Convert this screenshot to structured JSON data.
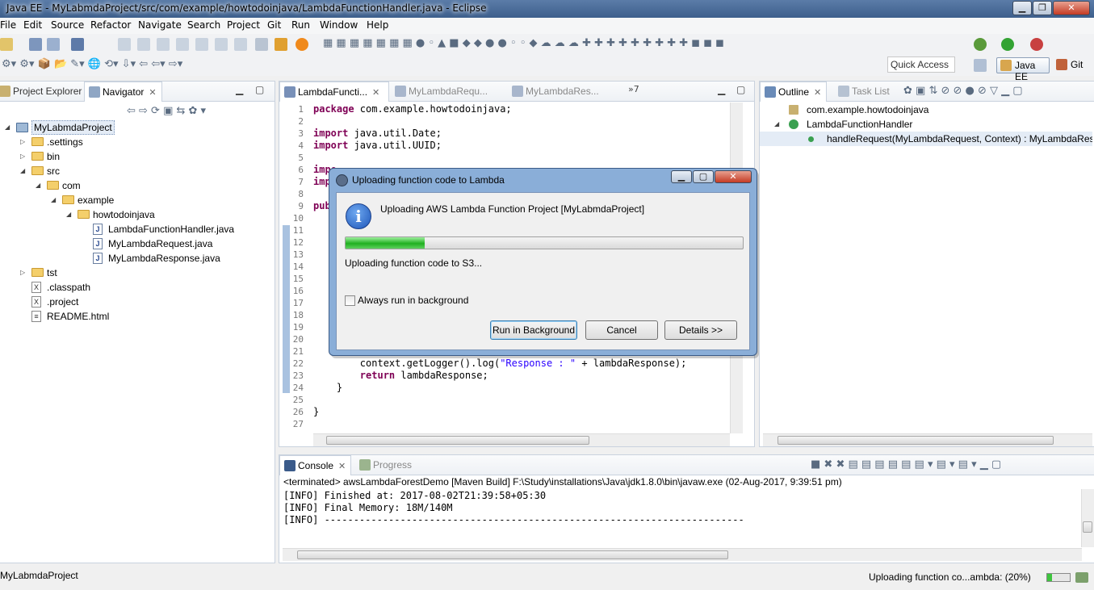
{
  "window": {
    "title": "Java EE - MyLabmdaProject/src/com/example/howtodoinjava/LambdaFunctionHandler.java - Eclipse"
  },
  "menu": [
    "File",
    "Edit",
    "Source",
    "Refactor",
    "Navigate",
    "Search",
    "Project",
    "Git",
    "Run",
    "Window",
    "Help"
  ],
  "quick_access": {
    "placeholder": "Quick Access"
  },
  "perspectives": {
    "java_ee": "Java EE",
    "git": "Git"
  },
  "left_panel": {
    "tabs": [
      "Project Explorer",
      "Navigator"
    ],
    "tree": [
      {
        "label": "MyLabmdaProject",
        "type": "project",
        "depth": 0,
        "expanded": true
      },
      {
        "label": ".settings",
        "type": "folder",
        "depth": 1,
        "expanded": false
      },
      {
        "label": "bin",
        "type": "folder",
        "depth": 1,
        "expanded": false
      },
      {
        "label": "src",
        "type": "folder",
        "depth": 1,
        "expanded": true
      },
      {
        "label": "com",
        "type": "folder",
        "depth": 2,
        "expanded": true
      },
      {
        "label": "example",
        "type": "folder",
        "depth": 3,
        "expanded": true
      },
      {
        "label": "howtodoinjava",
        "type": "folder",
        "depth": 4,
        "expanded": true
      },
      {
        "label": "LambdaFunctionHandler.java",
        "type": "java",
        "depth": 5
      },
      {
        "label": "MyLambdaRequest.java",
        "type": "java",
        "depth": 5
      },
      {
        "label": "MyLambdaResponse.java",
        "type": "java",
        "depth": 5
      },
      {
        "label": "tst",
        "type": "folder",
        "depth": 1,
        "expanded": false
      },
      {
        "label": ".classpath",
        "type": "xml",
        "depth": 1
      },
      {
        "label": ".project",
        "type": "xml",
        "depth": 1
      },
      {
        "label": "README.html",
        "type": "html",
        "depth": 1
      }
    ]
  },
  "editor": {
    "tabs": [
      "LambdaFuncti...",
      "MyLambdaRequ...",
      "MyLambdaRes..."
    ],
    "overflow": "»7",
    "lines": [
      {
        "n": "1",
        "t": "package com.example.howtodoinjava;"
      },
      {
        "n": "2",
        "t": ""
      },
      {
        "n": "3",
        "t": "import java.util.Date;"
      },
      {
        "n": "4",
        "t": "import java.util.UUID;"
      },
      {
        "n": "5",
        "t": ""
      },
      {
        "n": "6",
        "t": "impo"
      },
      {
        "n": "7",
        "t": "impo"
      },
      {
        "n": "8",
        "t": ""
      },
      {
        "n": "9",
        "t": "publ"
      },
      {
        "n": "10",
        "t": ""
      },
      {
        "n": "11",
        "t": ""
      },
      {
        "n": "12",
        "t": ""
      },
      {
        "n": "13",
        "t": ""
      },
      {
        "n": "14",
        "t": ""
      },
      {
        "n": "15",
        "t": ""
      },
      {
        "n": "16",
        "t": ""
      },
      {
        "n": "17",
        "t": ""
      },
      {
        "n": "18",
        "t": ""
      },
      {
        "n": "19",
        "t": ""
      },
      {
        "n": "20",
        "t": ""
      },
      {
        "n": "21",
        "t": ""
      },
      {
        "n": "22",
        "t": "        context.getLogger().log(\"Response : \" + lambdaResponse);"
      },
      {
        "n": "23",
        "t": "        return lambdaResponse;"
      },
      {
        "n": "24",
        "t": "    }"
      },
      {
        "n": "25",
        "t": ""
      },
      {
        "n": "26",
        "t": "}"
      },
      {
        "n": "27",
        "t": ""
      }
    ]
  },
  "outline": {
    "tabs": [
      "Outline",
      "Task List"
    ],
    "items": [
      {
        "label": "com.example.howtodoinjava",
        "depth": 0
      },
      {
        "label": "LambdaFunctionHandler",
        "depth": 0
      },
      {
        "label": "handleRequest(MyLambdaRequest, Context) : MyLambdaResp",
        "depth": 1
      }
    ]
  },
  "console": {
    "tabs": [
      "Console",
      "Progress"
    ],
    "header": "<terminated> awsLambdaForestDemo [Maven Build] F:\\Study\\installations\\Java\\jdk1.8.0\\bin\\javaw.exe (02-Aug-2017, 9:39:51 pm)",
    "lines": [
      "[INFO] Finished at: 2017-08-02T21:39:58+05:30",
      "[INFO] Final Memory: 18M/140M",
      "[INFO] ------------------------------------------------------------------------"
    ]
  },
  "status": {
    "left": "MyLabmdaProject",
    "progress_text": "Uploading function co...ambda: (20%)"
  },
  "dialog": {
    "title": "Uploading function code to Lambda",
    "message": "Uploading AWS Lambda Function Project [MyLabmdaProject]",
    "progress": 0.2,
    "sub_task": "Uploading function code to S3...",
    "checkbox_label": "Always run in background",
    "checkbox_checked": false,
    "buttons": {
      "background": "Run in Background",
      "cancel": "Cancel",
      "details": "Details >>"
    }
  }
}
